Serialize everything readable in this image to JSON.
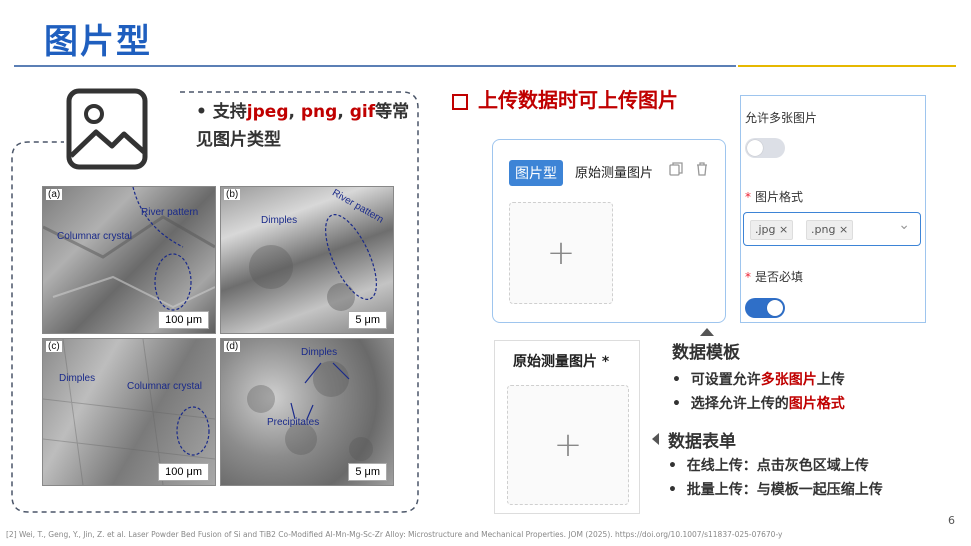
{
  "slide": {
    "title": "图片型",
    "page_number": "6",
    "footnote": "[2] Wei, T., Geng, Y., Jin, Z. et al. Laser Powder Bed Fusion of Si and TiB2 Co-Modified Al-Mn-Mg-Sc-Zr Alloy: Microstructure and Mechanical Properties. JOM (2025). https://doi.org/10.1007/s11837-025-07670-y"
  },
  "left": {
    "bullet_prefix": "支持",
    "fmt1": "jpeg",
    "sep1": ", ",
    "fmt2": "png",
    "sep2": ", ",
    "fmt3": "gif",
    "bullet_suffix": "等常见图片类型",
    "panels": [
      {
        "label": "(a)",
        "scale": "100 μm",
        "ann1": "River pattern",
        "ann2": "Columnar crystal"
      },
      {
        "label": "(b)",
        "scale": "5 μm",
        "ann1": "Dimples",
        "ann2": "River pattern"
      },
      {
        "label": "(c)",
        "scale": "100 μm",
        "ann1": "Dimples",
        "ann2": "Columnar crystal"
      },
      {
        "label": "(d)",
        "scale": "5 μm",
        "ann1": "Dimples",
        "ann2": "Precipitates"
      }
    ]
  },
  "upload_heading": "上传数据时可上传图片",
  "template_card": {
    "tag": "图片型",
    "label": "原始测量图片",
    "plus": "+"
  },
  "form_card": {
    "label": "原始测量图片 *",
    "plus": "+"
  },
  "properties": {
    "allow_multiple_label": "允许多张图片",
    "allow_multiple_on": false,
    "format_label": "图片格式",
    "formats": [
      ".jpg",
      ".png"
    ],
    "required_label": "是否必填",
    "required_on": true,
    "required_mark": "*",
    "chip_close": "×",
    "chevron": "⌄"
  },
  "template_section": {
    "title": "数据模板",
    "item1_prefix": "可设置允许",
    "item1_red": "多张图片",
    "item1_suffix": "上传",
    "item2_prefix": "选择允许上传的",
    "item2_red": "图片格式"
  },
  "form_section": {
    "title": "数据表单",
    "item1": "在线上传：点击灰色区域上传",
    "item2": "批量上传：与模板一起压缩上传"
  },
  "colors": {
    "title_blue": "#1f5fbf",
    "accent_red": "#c00000",
    "toggle_on": "#2f6fc8",
    "toggle_off": "#dcdfe6",
    "tag_blue": "#3d84d6"
  }
}
